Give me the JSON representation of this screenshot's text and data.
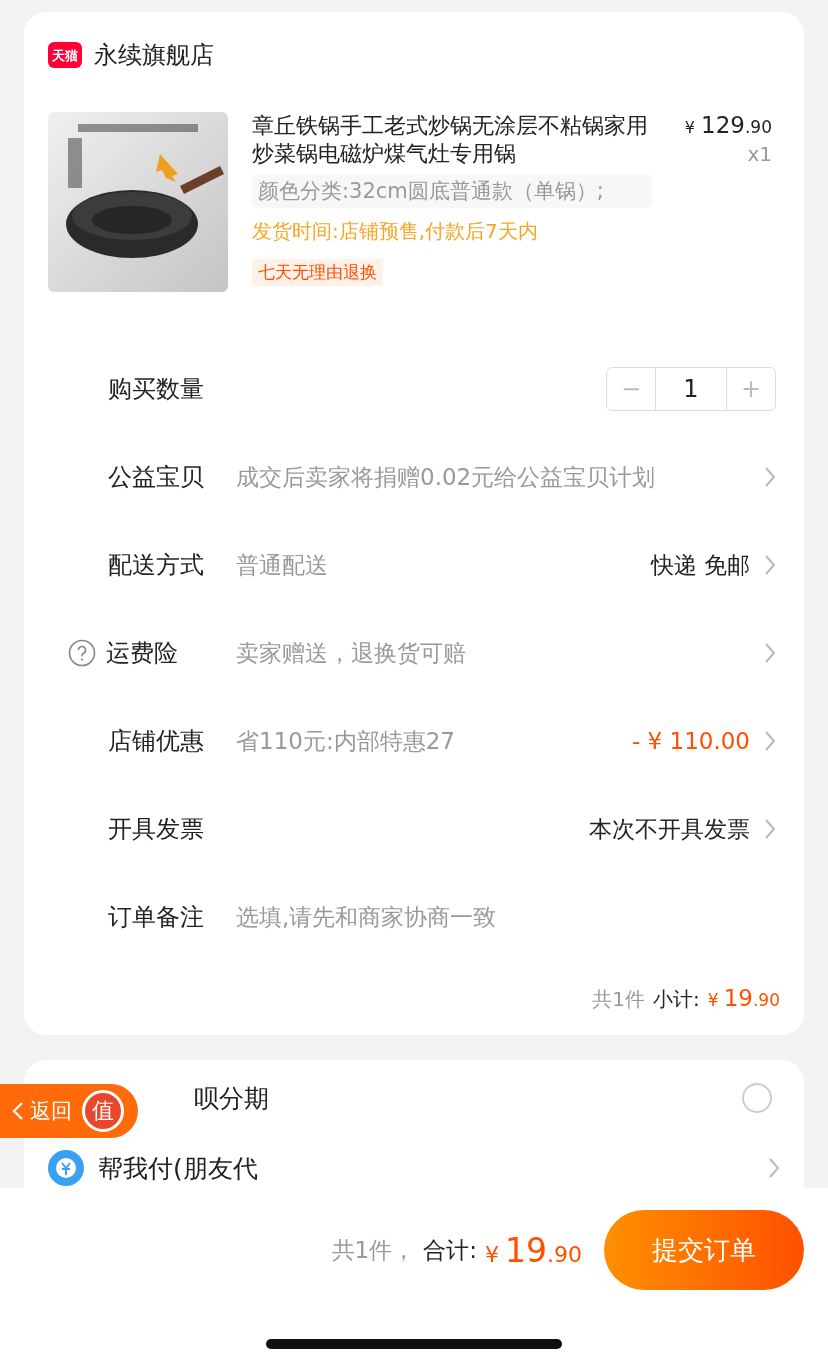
{
  "store": {
    "badge": "天猫",
    "name": "永续旗舰店"
  },
  "product": {
    "title": "章丘铁锅手工老式炒锅无涂层不粘锅家用炒菜锅电磁炉煤气灶专用锅",
    "spec": "颜色分类:32cm圆底普通款（单锅）;",
    "delivery": "发货时间:店铺预售,付款后7天内",
    "tag": "七天无理由退换",
    "currency": "¥",
    "price": "129",
    "price_decimal": ".90",
    "quantity": "x1"
  },
  "rows": [
    {
      "kind": "stepper",
      "label": "购买数量",
      "minus": "−",
      "value": "1",
      "plus": "+"
    },
    {
      "kind": "info",
      "label": "公益宝贝",
      "value": "成交后卖家将捐赠0.02元给公益宝贝计划"
    },
    {
      "kind": "info",
      "label": "配送方式",
      "value": "普通配送",
      "right": "快递 免邮"
    },
    {
      "kind": "info",
      "label": "运费险",
      "value": "卖家赠送，退换货可赔",
      "help_icon": true
    },
    {
      "kind": "info",
      "label": "店铺优惠",
      "value": "省110元:内部特惠27",
      "right": "- ¥ 110.00",
      "right_accent": true
    },
    {
      "kind": "info",
      "label": "开具发票",
      "right": "本次不开具发票"
    },
    {
      "kind": "note",
      "label": "订单备注",
      "placeholder": "选填,请先和商家协商一致"
    }
  ],
  "subtotal": {
    "count": "共1件",
    "label": "小计:",
    "currency": "¥",
    "amount": "19",
    "decimal": ".90"
  },
  "payment": [
    {
      "kind": "radio",
      "label": "呗分期",
      "selected": false
    },
    {
      "kind": "link",
      "label": "帮我付(朋友代"
    }
  ],
  "float_back": {
    "label": "返回",
    "badge": "值"
  },
  "footer": {
    "count": "共1件，",
    "label": "合计:",
    "currency": "¥",
    "amount": "19",
    "decimal": ".90",
    "button": "提交订单"
  }
}
